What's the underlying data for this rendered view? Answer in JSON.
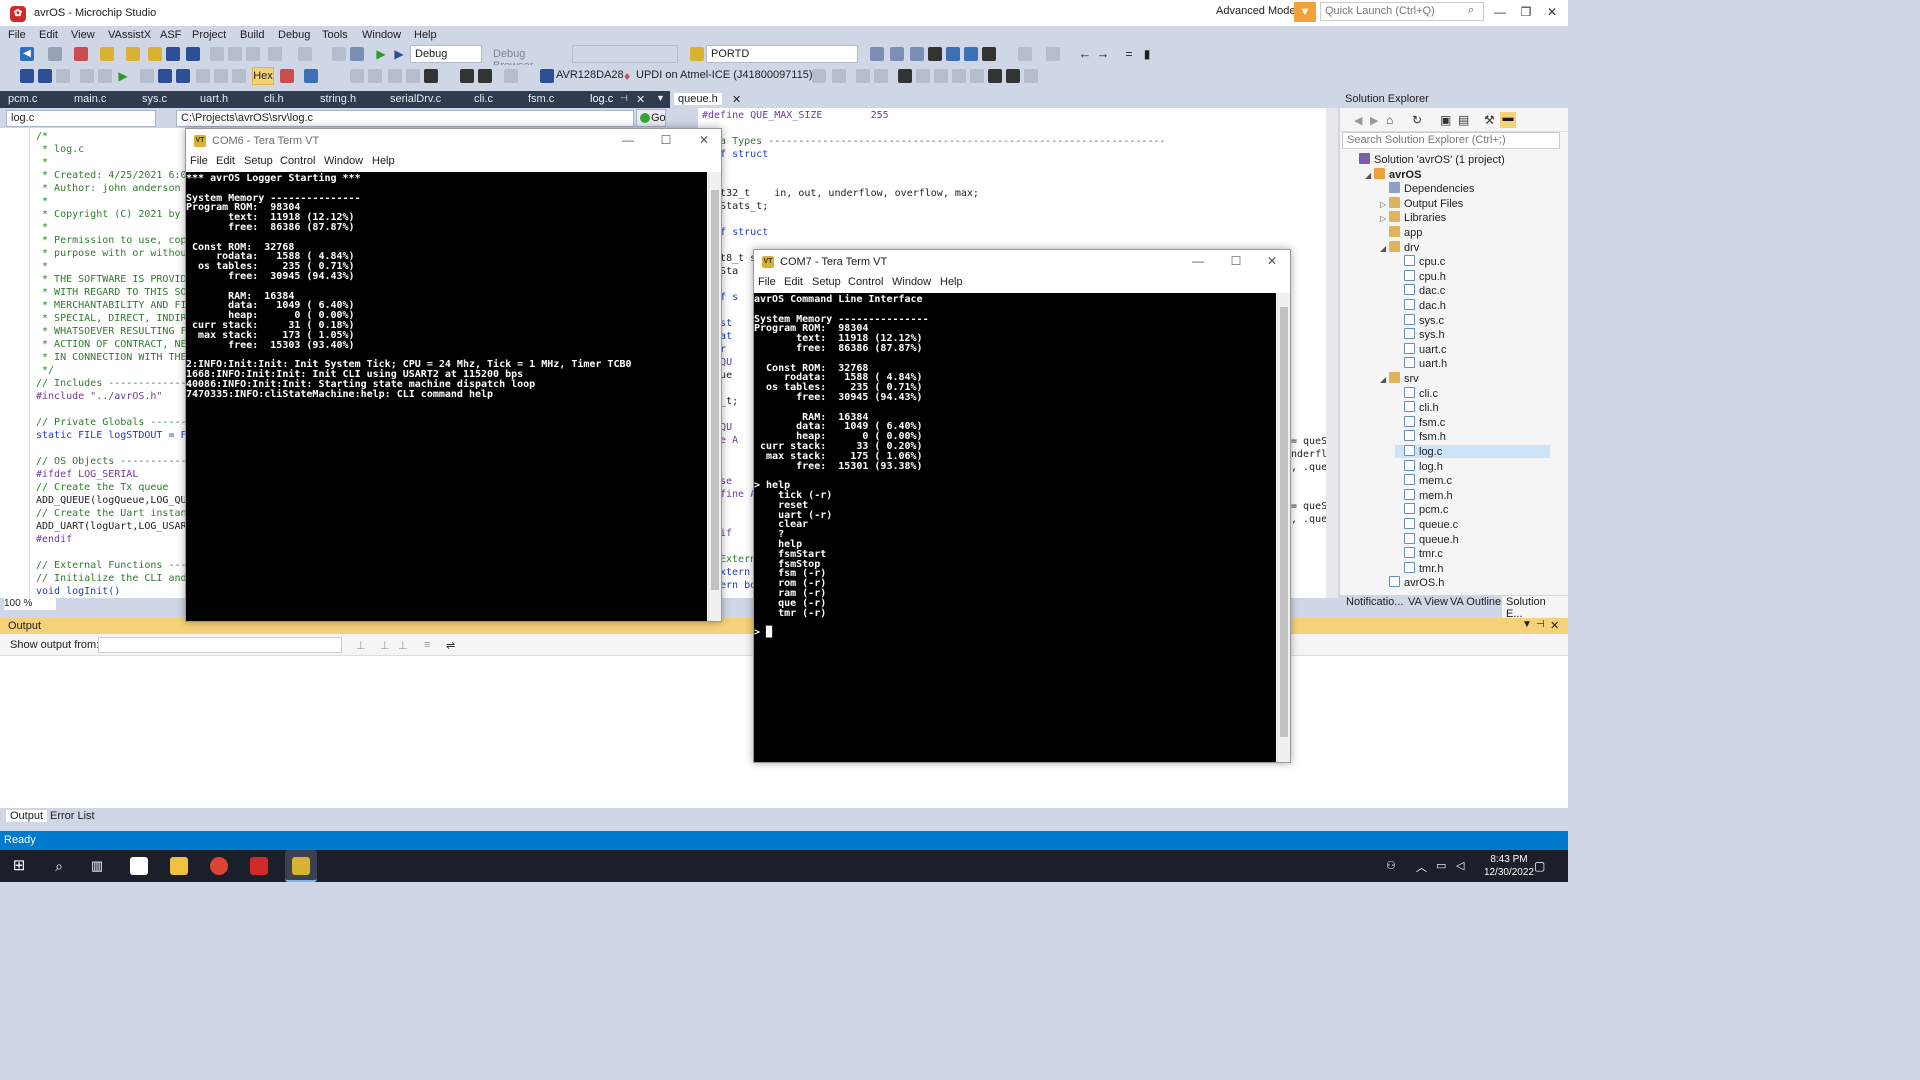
{
  "window": {
    "title": "avrOS - Microchip Studio",
    "advanced_mode": "Advanced Mode",
    "quick_launch_placeholder": "Quick Launch (Ctrl+Q)",
    "min": "—",
    "max": "❐",
    "close": "✕"
  },
  "menu": [
    "File",
    "Edit",
    "View",
    "VAssistX",
    "ASF",
    "Project",
    "Build",
    "Debug",
    "Tools",
    "Window",
    "Help"
  ],
  "toolbar": {
    "config": "Debug",
    "debug_browser": "Debug Browser",
    "find_value": "PORTD",
    "hex": "Hex",
    "device": "AVR128DA28",
    "tool": "UPDI on Atmel-ICE (J41800097115)"
  },
  "editor_tabs": [
    "pcm.c",
    "main.c",
    "sys.c",
    "uart.h",
    "cli.h",
    "string.h",
    "serialDrv.c",
    "cli.c",
    "fsm.c",
    "log.c"
  ],
  "editor_tab_active": "log.c",
  "right_tab": "queue.h",
  "nav": {
    "file": "log.c",
    "path": "C:\\Projects\\avrOS\\srv\\log.c",
    "go": "Go"
  },
  "zoom": "100 %",
  "code_left": [
    {
      "t": "/*",
      "c": "cm"
    },
    {
      "t": " * log.c",
      "c": "cm"
    },
    {
      "t": " *",
      "c": "cm"
    },
    {
      "t": " * Created: 4/25/2021 6:01",
      "c": "cm"
    },
    {
      "t": " * Author: john anderson",
      "c": "cm"
    },
    {
      "t": " *",
      "c": "cm"
    },
    {
      "t": " * Copyright (C) 2021 by J",
      "c": "cm"
    },
    {
      "t": " *",
      "c": "cm"
    },
    {
      "t": " * Permission to use, copy",
      "c": "cm"
    },
    {
      "t": " * purpose with or without",
      "c": "cm"
    },
    {
      "t": " *",
      "c": "cm"
    },
    {
      "t": " * THE SOFTWARE IS PROVIDE",
      "c": "cm"
    },
    {
      "t": " * WITH REGARD TO THIS SOF",
      "c": "cm"
    },
    {
      "t": " * MERCHANTABILITY AND FIT",
      "c": "cm"
    },
    {
      "t": " * SPECIAL, DIRECT, INDIRE",
      "c": "cm"
    },
    {
      "t": " * WHATSOEVER RESULTING FR",
      "c": "cm"
    },
    {
      "t": " * ACTION OF CONTRACT, NEG",
      "c": "cm"
    },
    {
      "t": " * IN CONNECTION WITH THE ",
      "c": "cm"
    },
    {
      "t": " */",
      "c": "cm"
    },
    {
      "t": "// Includes -------------",
      "c": "cm"
    },
    {
      "t": "#include \"../avrOS.h\"",
      "c": "pp"
    },
    {
      "t": "",
      "c": "plain"
    },
    {
      "t": "// Private Globals -------",
      "c": "cm"
    },
    {
      "t": "static FILE logSTDOUT = FD",
      "c": "kw"
    },
    {
      "t": "",
      "c": "plain"
    },
    {
      "t": "// OS Objects ------------",
      "c": "cm"
    },
    {
      "t": "#ifdef LOG_SERIAL",
      "c": "pp"
    },
    {
      "t": "// Create the Tx queue",
      "c": "cm"
    },
    {
      "t": "ADD_QUEUE(logQueue,LOG_QUE",
      "c": "plain"
    },
    {
      "t": "// Create the Uart instanc",
      "c": "cm"
    },
    {
      "t": "ADD_UART(logUart,LOG_USART",
      "c": "plain"
    },
    {
      "t": "#endif",
      "c": "pp"
    },
    {
      "t": "",
      "c": "plain"
    },
    {
      "t": "// External Functions ----",
      "c": "cm"
    },
    {
      "t": "// Initialize the CLI and ",
      "c": "cm"
    },
    {
      "t": "void logInit()",
      "c": "kw"
    }
  ],
  "code_right": [
    {
      "t": "#define QUE_MAX_SIZE        255",
      "c": "pp"
    },
    {
      "t": "",
      "c": "plain"
    },
    {
      "t": "Data Types ------------------------------------------------------------------",
      "c": "cm"
    },
    {
      "t": "edef struct",
      "c": "kw"
    },
    {
      "t": "",
      "c": "plain"
    },
    {
      "t": "",
      "c": "plain"
    },
    {
      "t": "uint32_t    in, out, underflow, overflow, max;",
      "c": "plain"
    },
    {
      "t": "eueStats_t;",
      "c": "plain"
    },
    {
      "t": "",
      "c": "plain"
    },
    {
      "t": "edef struct",
      "c": "kw"
    },
    {
      "t": "",
      "c": "plain"
    },
    {
      "t": "uint8_t size,head,tail;",
      "c": "plain"
    },
    {
      "t": "eueSta",
      "c": "plain"
    },
    {
      "t": "",
      "c": "plain"
    },
    {
      "t": "edef s",
      "c": "kw"
    },
    {
      "t": "",
      "c": "plain"
    },
    {
      "t": "const",
      "c": "kw"
    },
    {
      "t": "volat",
      "c": "kw"
    },
    {
      "t": "char",
      "c": "kw"
    },
    {
      "t": "ef QU",
      "c": "pp"
    },
    {
      "t": "Queue",
      "c": "plain"
    },
    {
      "t": "if",
      "c": "pp"
    },
    {
      "t": "eue_t;",
      "c": "plain"
    },
    {
      "t": "",
      "c": "plain"
    },
    {
      "t": "ef QU",
      "c": "pp"
    },
    {
      "t": "fine A",
      "c": "pp"
    }
  ],
  "code_right_tail": [
    {
      "t": "se",
      "c": "pp"
    },
    {
      "t": "fine A",
      "c": "pp"
    },
    {
      "t": "",
      "c": "plain"
    },
    {
      "t": "",
      "c": "plain"
    },
    {
      "t": "if",
      "c": "pp"
    },
    {
      "t": "",
      "c": "plain"
    },
    {
      "t": "Extern",
      "c": "cm"
    },
    {
      "t": "xtern",
      "c": "kw"
    },
    {
      "t": "ern bo",
      "c": "kw"
    }
  ],
  "code_right_far": [
    "= queS",
    "nderfl",
    ", .que",
    "",
    "",
    "= queS",
    ", .que"
  ],
  "solution": {
    "title": "Solution Explorer",
    "search_placeholder": "Search Solution Explorer (Ctrl+;)",
    "items": [
      {
        "label": "Solution 'avrOS' (1 project)",
        "indent": 0,
        "icon": "sol",
        "arrow": ""
      },
      {
        "label": "avrOS",
        "indent": 1,
        "icon": "proj",
        "arrow": "◢",
        "bold": true
      },
      {
        "label": "Dependencies",
        "indent": 2,
        "icon": "ref",
        "arrow": ""
      },
      {
        "label": "Output Files",
        "indent": 2,
        "icon": "folder",
        "arrow": "▷"
      },
      {
        "label": "Libraries",
        "indent": 2,
        "icon": "folder",
        "arrow": "▷"
      },
      {
        "label": "app",
        "indent": 2,
        "icon": "folder",
        "arrow": ""
      },
      {
        "label": "drv",
        "indent": 2,
        "icon": "folder",
        "arrow": "◢"
      },
      {
        "label": "cpu.c",
        "indent": 3,
        "icon": "file",
        "arrow": ""
      },
      {
        "label": "cpu.h",
        "indent": 3,
        "icon": "file",
        "arrow": ""
      },
      {
        "label": "dac.c",
        "indent": 3,
        "icon": "file",
        "arrow": ""
      },
      {
        "label": "dac.h",
        "indent": 3,
        "icon": "file",
        "arrow": ""
      },
      {
        "label": "sys.c",
        "indent": 3,
        "icon": "file",
        "arrow": ""
      },
      {
        "label": "sys.h",
        "indent": 3,
        "icon": "file",
        "arrow": ""
      },
      {
        "label": "uart.c",
        "indent": 3,
        "icon": "file",
        "arrow": ""
      },
      {
        "label": "uart.h",
        "indent": 3,
        "icon": "file",
        "arrow": ""
      },
      {
        "label": "srv",
        "indent": 2,
        "icon": "folder",
        "arrow": "◢"
      },
      {
        "label": "cli.c",
        "indent": 3,
        "icon": "file",
        "arrow": ""
      },
      {
        "label": "cli.h",
        "indent": 3,
        "icon": "file",
        "arrow": ""
      },
      {
        "label": "fsm.c",
        "indent": 3,
        "icon": "file",
        "arrow": ""
      },
      {
        "label": "fsm.h",
        "indent": 3,
        "icon": "file",
        "arrow": ""
      },
      {
        "label": "log.c",
        "indent": 3,
        "icon": "file",
        "arrow": "",
        "selected": true
      },
      {
        "label": "log.h",
        "indent": 3,
        "icon": "file",
        "arrow": ""
      },
      {
        "label": "mem.c",
        "indent": 3,
        "icon": "file",
        "arrow": ""
      },
      {
        "label": "mem.h",
        "indent": 3,
        "icon": "file",
        "arrow": ""
      },
      {
        "label": "pcm.c",
        "indent": 3,
        "icon": "file",
        "arrow": ""
      },
      {
        "label": "queue.c",
        "indent": 3,
        "icon": "file",
        "arrow": ""
      },
      {
        "label": "queue.h",
        "indent": 3,
        "icon": "file",
        "arrow": ""
      },
      {
        "label": "tmr.c",
        "indent": 3,
        "icon": "file",
        "arrow": ""
      },
      {
        "label": "tmr.h",
        "indent": 3,
        "icon": "file",
        "arrow": ""
      },
      {
        "label": "avrOS.h",
        "indent": 2,
        "icon": "file",
        "arrow": ""
      }
    ],
    "tabs": [
      "Notificatio...",
      "VA View",
      "VA Outline",
      "Solution E..."
    ]
  },
  "output": {
    "title": "Output",
    "show_from": "Show output from:",
    "tabs": [
      "Output",
      "Error List"
    ]
  },
  "status": "Ready",
  "clock": {
    "time": "8:43 PM",
    "date": "12/30/2022"
  },
  "com6": {
    "title": "COM6 - Tera Term VT",
    "menu": [
      "File",
      "Edit",
      "Setup",
      "Control",
      "Window",
      "Help"
    ],
    "text": "*** avrOS Logger Starting ***\n\nSystem Memory ---------------\nProgram ROM:  98304\n       text:  11918 (12.12%)\n       free:  86386 (87.87%)\n\n Const ROM:  32768\n     rodata:   1588 ( 4.84%)\n  os tables:    235 ( 0.71%)\n       free:  30945 (94.43%)\n\n       RAM:  16384\n       data:   1049 ( 6.40%)\n       heap:      0 ( 0.00%)\n curr stack:     31 ( 0.18%)\n  max stack:    173 ( 1.05%)\n       free:  15303 (93.40%)\n\n2:INFO:Init:Init: Init System Tick; CPU = 24 Mhz, Tick = 1 MHz, Timer TCB0\n1668:INFO:Init:Init: Init CLI using USART2 at 115200 bps\n40086:INFO:Init:Init: Starting state machine dispatch loop\n7470335:INFO:cliStateMachine:help: CLI command help"
  },
  "com7": {
    "title": "COM7 - Tera Term VT",
    "menu": [
      "File",
      "Edit",
      "Setup",
      "Control",
      "Window",
      "Help"
    ],
    "text": "avrOS Command Line Interface\n\nSystem Memory ---------------\nProgram ROM:  98304\n       text:  11918 (12.12%)\n       free:  86386 (87.87%)\n\n  Const ROM:  32768\n     rodata:   1588 ( 4.84%)\n  os tables:    235 ( 0.71%)\n       free:  30945 (94.43%)\n\n        RAM:  16384\n       data:   1049 ( 6.40%)\n       heap:      0 ( 0.00%)\n curr stack:     33 ( 0.20%)\n  max stack:    175 ( 1.06%)\n       free:  15301 (93.38%)\n\n> help\n    tick (-r)\n    reset\n    uart (-r)\n    clear\n    ?\n    help\n    fsmStart\n    fsmStop\n    fsm (-r)\n    rom (-r)\n    ram (-r)\n    que (-r)\n    tmr (-r)\n\n> █"
  }
}
